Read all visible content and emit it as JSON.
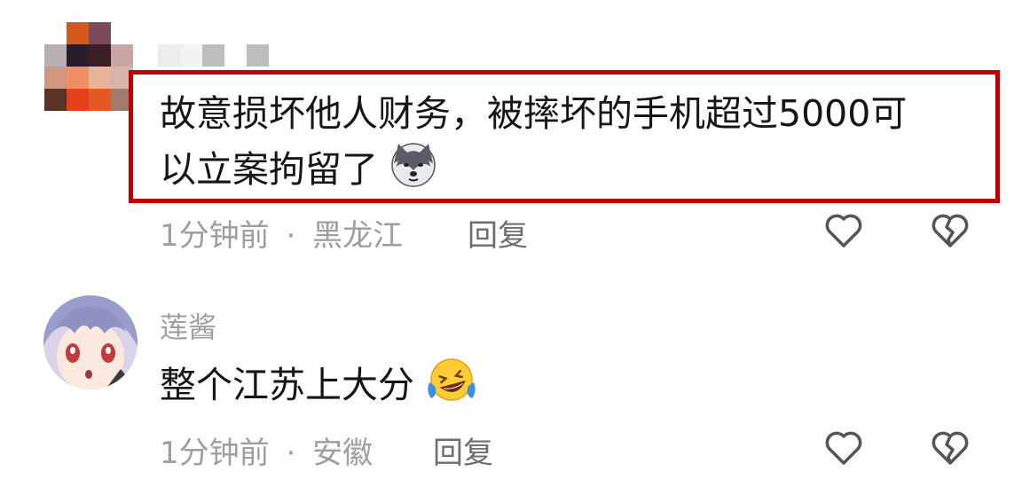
{
  "comments": [
    {
      "author": "",
      "text_line1": "故意损坏他人财务，被摔坏的手机超过5000可",
      "text_line2": "以立案拘留了",
      "emoji": "husky-dog-emoji",
      "time": "1分钟前",
      "separator": "·",
      "location": "黑龙江",
      "reply_label": "回复"
    },
    {
      "author": "莲酱",
      "text": "整个江苏上大分",
      "emoji": "laughing-tears-emoji",
      "time": "1分钟前",
      "separator": "·",
      "location": "安徽",
      "reply_label": "回复"
    }
  ],
  "icons": [
    "heart-icon",
    "broken-heart-icon"
  ],
  "colors": {
    "highlight_border": "#c00000",
    "meta_text": "#9e9e9e",
    "body_text": "#161616"
  }
}
